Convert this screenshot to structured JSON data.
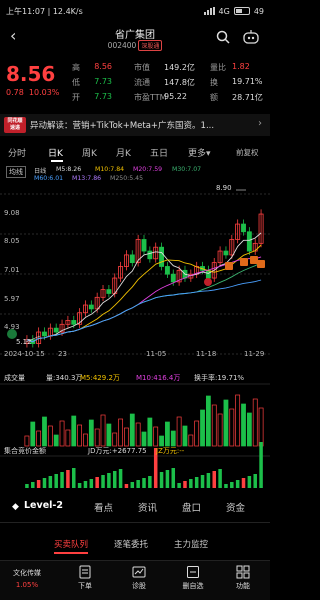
{
  "status": {
    "time": "上午11:07",
    "speed": "12.4K/s",
    "network": "4G",
    "battery": "49"
  },
  "header": {
    "title": "省广集团",
    "code": "002400",
    "tag": "深股通"
  },
  "quote": {
    "price": "8.56",
    "change": "0.78",
    "change_pct": "10.03%",
    "cells": [
      {
        "label": "高",
        "value": "8.56",
        "cls": "red"
      },
      {
        "label": "市值",
        "value": "149.2亿",
        "cls": "white"
      },
      {
        "label": "量比",
        "value": "1.82",
        "cls": "red"
      },
      {
        "label": "低",
        "value": "7.73",
        "cls": "green"
      },
      {
        "label": "流通",
        "value": "147.8亿",
        "cls": "white"
      },
      {
        "label": "换",
        "value": "19.71%",
        "cls": "white"
      },
      {
        "label": "开",
        "value": "7.73",
        "cls": "green"
      },
      {
        "label": "市盈TTM",
        "value": "95.22",
        "cls": "white"
      },
      {
        "label": "额",
        "value": "28.71亿",
        "cls": "white"
      }
    ]
  },
  "news": {
    "logo_top": "同花顺",
    "logo_bottom": "速递",
    "text": "异动解读：营销+TikTok+Meta+广东国资。1..."
  },
  "tabs": [
    "分时",
    "日K",
    "周K",
    "月K",
    "五日",
    "更多",
    "前复权"
  ],
  "ma": {
    "label": "均线",
    "line": "日线",
    "ma5": "M5:8.26",
    "ma10": "M10:7.84",
    "ma20": "M20:7.59",
    "ma30": "M30:7.07",
    "ma60": "M60:6.01",
    "ma13": "M13:7.86",
    "ma250": "M250:5.45"
  },
  "axis": {
    "y_ticks": [
      "9.08",
      "8.05",
      "7.01",
      "5.97",
      "4.93"
    ],
    "high_label": "8.90",
    "low_label": "5.12",
    "x_labels": [
      "2024-10-15",
      "23",
      "11-05",
      "11-18",
      "11-29"
    ]
  },
  "volume": {
    "label": "成交量",
    "vol": "量:340.3万",
    "m5": "M5:429.2万",
    "m10": "M10:416.4万",
    "turnover": "换手率:19.71%"
  },
  "auction": {
    "label": "集合竞价金额",
    "jd": "JD万元:+2677.75",
    "jz": "JZ万元:--"
  },
  "chart_data": {
    "type": "candlestick",
    "x_range": [
      "2024-10-15",
      "11-29"
    ],
    "ylim": [
      4.93,
      9.08
    ],
    "high": 8.9,
    "low": 5.12,
    "closes": [
      5.3,
      5.2,
      5.5,
      5.4,
      5.6,
      5.5,
      5.7,
      5.8,
      5.7,
      6.0,
      6.2,
      6.1,
      6.4,
      6.6,
      6.5,
      6.9,
      7.2,
      7.5,
      7.3,
      7.9,
      7.6,
      7.4,
      7.7,
      7.2,
      7.0,
      6.8,
      7.1,
      6.9,
      7.0,
      7.2,
      7.1,
      6.9,
      7.3,
      7.6,
      7.5,
      7.9,
      8.3,
      8.1,
      7.6,
      7.8,
      8.56
    ]
  },
  "bottom_tabs": [
    "Level-2",
    "看点",
    "资讯",
    "盘口",
    "资金"
  ],
  "sub_tabs": [
    "买卖队列",
    "逐笔委托",
    "主力监控"
  ],
  "toolbar": [
    {
      "label": "文化传媒",
      "sub": "1.05%"
    },
    {
      "label": "下单",
      "sub": ""
    },
    {
      "label": "诊股",
      "sub": ""
    },
    {
      "label": "删自选",
      "sub": ""
    },
    {
      "label": "功能",
      "sub": ""
    }
  ],
  "colors": {
    "up": "#ff4040",
    "down": "#1cbf4a",
    "bg": "#000000"
  }
}
